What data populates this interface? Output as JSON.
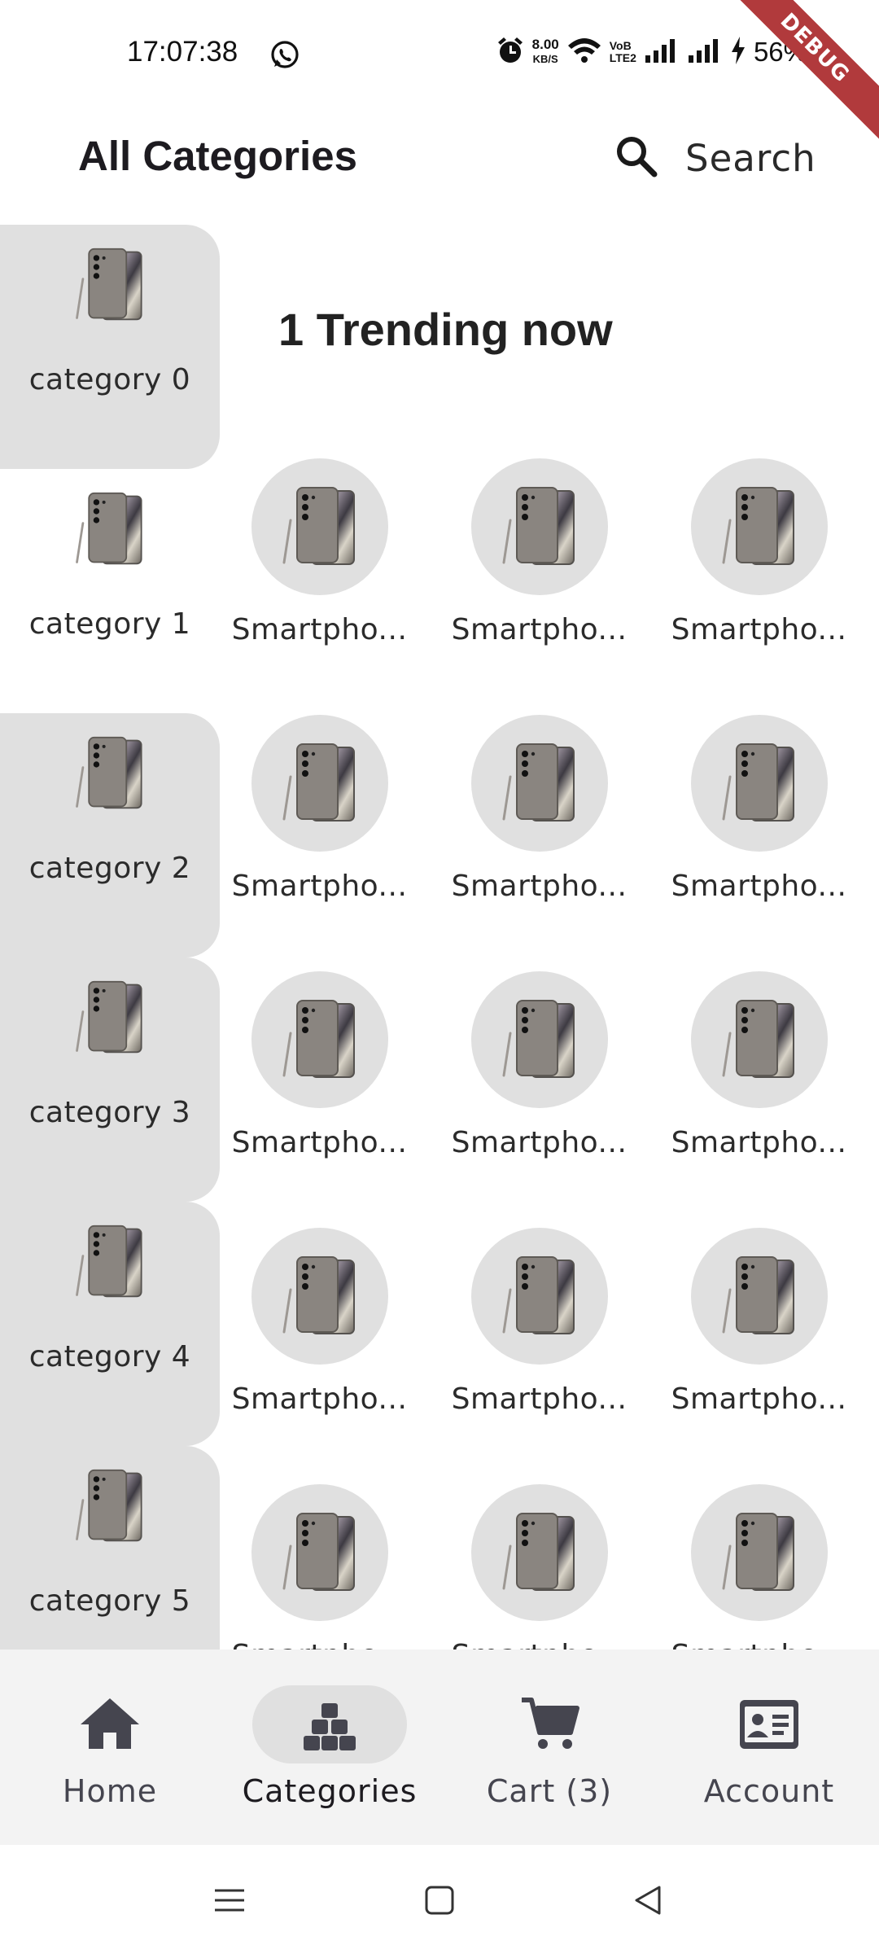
{
  "status_bar": {
    "time": "17:07:38",
    "net_speed_value": "8.00",
    "net_speed_unit": "KB/S",
    "volte_top": "VoB",
    "volte_bottom": "LTE2",
    "battery": "56%",
    "icons": [
      "whatsapp-icon",
      "alarm-icon",
      "wifi-icon",
      "signal-icon",
      "signal-icon",
      "charging-icon"
    ]
  },
  "debug_banner": "DEBUG",
  "app_bar": {
    "title": "All Categories",
    "search_label": "Search"
  },
  "sidebar": {
    "items": [
      {
        "label": "category 0",
        "selected": false
      },
      {
        "label": "category 1",
        "selected": true
      },
      {
        "label": "category 2",
        "selected": false
      },
      {
        "label": "category 3",
        "selected": false
      },
      {
        "label": "category 4",
        "selected": false
      },
      {
        "label": "category 5",
        "selected": false
      }
    ]
  },
  "main": {
    "section_title": "1 Trending now",
    "product_label": "Smartpho...",
    "rows": 5,
    "columns": 3
  },
  "bottom_nav": {
    "items": [
      {
        "label": "Home",
        "icon": "home-icon",
        "active": false
      },
      {
        "label": "Categories",
        "icon": "categories-icon",
        "active": true
      },
      {
        "label": "Cart (3)",
        "icon": "cart-icon",
        "active": false
      },
      {
        "label": "Account",
        "icon": "account-card-icon",
        "active": false
      }
    ]
  },
  "colors": {
    "shaded": "#e0e0e0",
    "nav_bg": "#f3f3f3",
    "icon": "#45454f",
    "debug": "#b13a3c"
  }
}
